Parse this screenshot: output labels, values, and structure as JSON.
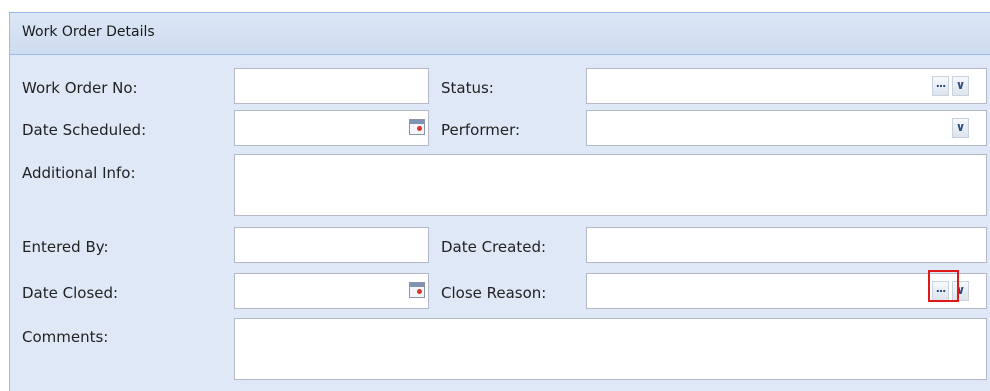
{
  "panel": {
    "title": "Work Order Details"
  },
  "fields": {
    "work_order_no": {
      "label": "Work Order No:",
      "value": ""
    },
    "status": {
      "label": "Status:",
      "value": ""
    },
    "date_scheduled": {
      "label": "Date Scheduled:",
      "value": ""
    },
    "performer": {
      "label": "Performer:",
      "value": ""
    },
    "additional_info": {
      "label": "Additional Info:",
      "value": ""
    },
    "entered_by": {
      "label": "Entered By:",
      "value": ""
    },
    "date_created": {
      "label": "Date Created:",
      "value": ""
    },
    "date_closed": {
      "label": "Date Closed:",
      "value": ""
    },
    "close_reason": {
      "label": "Close Reason:",
      "value": ""
    },
    "comments": {
      "label": "Comments:",
      "value": ""
    }
  },
  "icons": {
    "ellipsis": "...",
    "chevron": "∨",
    "calendar": "calendar-icon"
  },
  "colors": {
    "panel_bg": "#dfe8f6",
    "panel_border": "#99bbe8",
    "highlight": "#e01818"
  }
}
